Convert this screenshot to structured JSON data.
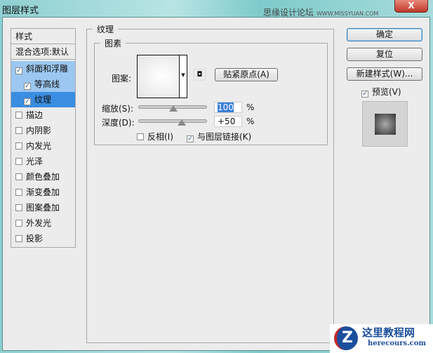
{
  "window": {
    "title": "图层样式",
    "watermark": "思缘设计论坛",
    "watermark_url": "WWW.MISSYUAN.COM",
    "close": "X"
  },
  "sidebar": {
    "header": "样式",
    "blend": "混合选项:默认",
    "items": [
      {
        "label": "斜面和浮雕",
        "checked": true
      },
      {
        "label": "等高线",
        "checked": true
      },
      {
        "label": "纹理",
        "checked": true
      },
      {
        "label": "描边",
        "checked": false
      },
      {
        "label": "内阴影",
        "checked": false
      },
      {
        "label": "内发光",
        "checked": false
      },
      {
        "label": "光泽",
        "checked": false
      },
      {
        "label": "颜色叠加",
        "checked": false
      },
      {
        "label": "渐变叠加",
        "checked": false
      },
      {
        "label": "图案叠加",
        "checked": false
      },
      {
        "label": "外发光",
        "checked": false
      },
      {
        "label": "投影",
        "checked": false
      }
    ]
  },
  "main": {
    "group_title": "纹理",
    "sub_title": "图素",
    "pattern_label": "图案:",
    "snap_button": "贴紧原点(A)",
    "scale_label": "缩放(S):",
    "scale_value": "100",
    "scale_pct": 50,
    "depth_label": "深度(D):",
    "depth_value": "+50",
    "depth_pct": 62,
    "percent": "%",
    "invert_label": "反相(I)",
    "invert_checked": false,
    "link_label": "与图层链接(K)",
    "link_checked": true
  },
  "right": {
    "ok": "确定",
    "reset": "复位",
    "new_style": "新建样式(W)...",
    "preview_label": "预览(V)",
    "preview_checked": true
  },
  "logo": {
    "name": "这里教程网",
    "url": "herecours.com"
  },
  "check": "✓"
}
